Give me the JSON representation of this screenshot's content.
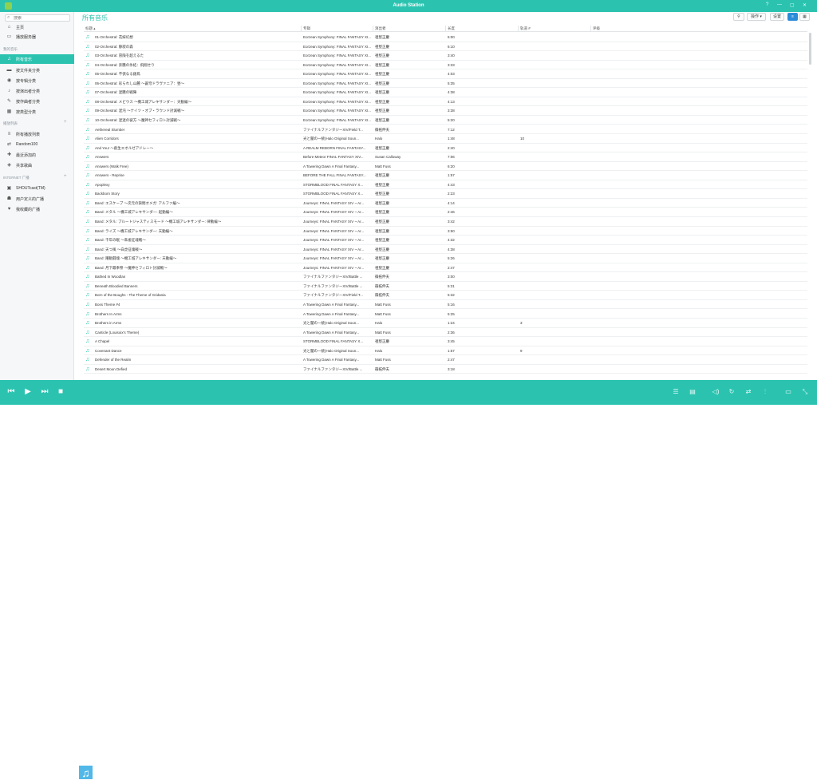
{
  "app": {
    "title": "Audio Station",
    "window_controls": [
      "?",
      "—",
      "▢",
      "✕"
    ]
  },
  "sidebar": {
    "search_placeholder": "搜索",
    "top_items": [
      {
        "label": "主页",
        "icon": "home-icon"
      },
      {
        "label": "播放服务器",
        "icon": "server-icon"
      }
    ],
    "library_section": "我的音乐",
    "library_items": [
      {
        "label": "所有音乐",
        "icon": "music-note-icon",
        "active": true
      },
      {
        "label": "按文件夹分类",
        "icon": "folder-icon"
      },
      {
        "label": "按专辑分类",
        "icon": "album-icon"
      },
      {
        "label": "按演出者分类",
        "icon": "microphone-icon"
      },
      {
        "label": "按作曲者分类",
        "icon": "composer-icon"
      },
      {
        "label": "按类型分类",
        "icon": "genre-icon"
      }
    ],
    "playlist_section": "播放列表",
    "playlist_items": [
      {
        "label": "所有播放列表",
        "icon": "list-icon"
      },
      {
        "label": "Random100",
        "icon": "shuffle-list-icon"
      },
      {
        "label": "最近添加的",
        "icon": "recent-icon"
      },
      {
        "label": "共享歌曲",
        "icon": "share-icon"
      }
    ],
    "radio_section": "INTERNET 广播",
    "radio_items": [
      {
        "label": "SHOUTcast(TM)",
        "icon": "radio-icon"
      },
      {
        "label": "用户定义的广播",
        "icon": "user-radio-icon"
      },
      {
        "label": "我收藏的广播",
        "icon": "heart-icon"
      }
    ]
  },
  "main": {
    "title": "所有音乐",
    "toolbar": {
      "action_label": "操作 ▾",
      "settings_label": "设置"
    },
    "columns": [
      "标题 ▴",
      "专辑",
      "演出者",
      "长度",
      "轨道 #",
      "评级"
    ],
    "rows": [
      [
        "01-Orchestral: 花嫁幻想",
        "Eorzean Symphony: FINAL FANTASY XI...",
        "祖堅正慶",
        "5:00",
        ""
      ],
      [
        "02-Orchestral: 静寂の森",
        "Eorzean Symphony: FINAL FANTASY XI...",
        "祖堅正慶",
        "6:10",
        ""
      ],
      [
        "03-Orchestral: 冒険を超えるた",
        "Eorzean Symphony: FINAL FANTASY XI...",
        "祖堅正慶",
        "3:40",
        ""
      ],
      [
        "04-Orchestral: 奔騰の氷結：飛翔せり",
        "Eorzean Symphony: FINAL FANTASY XI...",
        "祖堅正慶",
        "3:33",
        ""
      ],
      [
        "05-Orchestral: 不倶なる銀鳥",
        "Eorzean Symphony: FINAL FANTASY XI...",
        "祖堅正慶",
        "4:03",
        ""
      ],
      [
        "06-Orchestral: 彩られし山麓 ～蒼穹ドラヴァニア：昼～",
        "Eorzean Symphony: FINAL FANTASY XI...",
        "祖堅正慶",
        "5:35",
        ""
      ],
      [
        "07-Orchestral: 混騰の戦陣",
        "Eorzean Symphony: FINAL FANTASY XI...",
        "祖堅正慶",
        "4:38",
        ""
      ],
      [
        "08-Orchestral: メビウス ～機工城アレキサンダー：天動編～",
        "Eorzean Symphony: FINAL FANTASY XI...",
        "祖堅正慶",
        "4:13",
        ""
      ],
      [
        "09-Orchestral: 混沌 ～ナイツ・オブ・ラウンド討滅戦～",
        "Eorzean Symphony: FINAL FANTASY XI...",
        "祖堅正慶",
        "3:38",
        ""
      ],
      [
        "10-Orchestral: 混迷の彼方 ～魔神セフィロト討滅戦～",
        "Eorzean Symphony: FINAL FANTASY XI...",
        "祖堅正慶",
        "5:20",
        ""
      ],
      [
        "Aethereal Slumber",
        "ファイナルファンタジーXIV/Field T...",
        "篠拓伸夫",
        "7:12",
        ""
      ],
      [
        "Alien Corridors",
        "光と闇の一統(Halo Original Soun...",
        "Halo",
        "1:48",
        "10"
      ],
      [
        "And You! ～創生エオルゼアドレー～",
        "A REALM REBORN FINAL FANTASY...",
        "祖堅正慶",
        "2:40",
        ""
      ],
      [
        "Answers",
        "Before Meteor FINAL FANTASY XIV...",
        "Susan Calloway",
        "7:06",
        ""
      ],
      [
        "Answers (Walk Free)",
        "A Towering Dawn A Final Fantasy...",
        "Matt Fuss",
        "6:20",
        ""
      ],
      [
        "Answers - Reprise",
        "BEFORE THE FALL FINAL FANTASY...",
        "祖堅正慶",
        "1:57",
        ""
      ],
      [
        "Apoplexy",
        "STORMBLOOD FINAL FANTASY X...",
        "祖堅正慶",
        "4:43",
        ""
      ],
      [
        "Backborn Story",
        "STORMBLOOD FINAL FANTASY X...",
        "祖堅正慶",
        "2:23",
        ""
      ],
      [
        "Band: エスケープ ～次元の狭間オメガ: アルファ編～",
        "Journeys: FINAL FANTASY XIV ~ Ar...",
        "祖堅正慶",
        "4:14",
        ""
      ],
      [
        "Band: メタル ～機工城アレキサンダー: 起動編～",
        "Journeys: FINAL FANTASY XIV ~ Ar...",
        "祖堅正慶",
        "2:46",
        ""
      ],
      [
        "Band: メタル: ブルートジャスティスモード ～機工城アレキサンダー: 律動編～",
        "Journeys: FINAL FANTASY XIV ~ Ar...",
        "祖堅正慶",
        "3:42",
        ""
      ],
      [
        "Band: ライズ ～機工城アレキサンダー: 天動編～",
        "Journeys: FINAL FANTASY XIV ~ Ar...",
        "祖堅正慶",
        "3:50",
        ""
      ],
      [
        "Band: 千年の眠 ～朱雀征魂戦～",
        "Journeys: FINAL FANTASY XIV ~ Ar...",
        "祖堅正慶",
        "4:32",
        ""
      ],
      [
        "Band: 天つ風 ～白虎征魂戦～",
        "Journeys: FINAL FANTASY XIV ~ Ar...",
        "祖堅正慶",
        "4:38",
        ""
      ],
      [
        "Band: 躍動闘魂 ～機工城アレキサンダー: 天動編～",
        "Journeys: FINAL FANTASY XIV ~ Ar...",
        "祖堅正慶",
        "5:26",
        ""
      ],
      [
        "Band: 月下最奉祭 ～魔神セフィロト討滅戦～",
        "Journeys: FINAL FANTASY XIV ~ Ar...",
        "祖堅正慶",
        "2:47",
        ""
      ],
      [
        "Bathed In Woodlan",
        "ファイナルファンタジーXIV/Battle ...",
        "篠拓伸夫",
        "3:00",
        ""
      ],
      [
        "Beneath Bloodied Banners",
        "ファイナルファンタジーXIV/Battle ...",
        "篠拓伸夫",
        "5:31",
        ""
      ],
      [
        "Born of the Boughs - The Theme of Gridania",
        "ファイナルファンタジーXIV/Field T...",
        "篠拓伸夫",
        "5:32",
        ""
      ],
      [
        "Boss Theme #4",
        "A Towering Dawn A Final Fantasy...",
        "Matt Fuss",
        "5:16",
        ""
      ],
      [
        "Brothers In Arms",
        "A Towering Dawn A Final Fantasy...",
        "Matt Fuss",
        "5:25",
        ""
      ],
      [
        "Brothers in Arms",
        "光と闇の一統(Halo Original Soun...",
        "Halo",
        "1:24",
        "3"
      ],
      [
        "Canticle (Louisoix's Theme)",
        "A Towering Dawn A Final Fantasy...",
        "Matt Fuss",
        "2:36",
        ""
      ],
      [
        "A Chapel",
        "STORMBLOOD FINAL FANTASY X...",
        "祖堅正慶",
        "3:45",
        ""
      ],
      [
        "Covenant Dance",
        "光と闇の一統(Halo Original Soun...",
        "Halo",
        "1:57",
        "9"
      ],
      [
        "Defender of the Realm",
        "A Towering Dawn A Final Fantasy...",
        "Matt Fuss",
        "2:47",
        ""
      ],
      [
        "Desert Moon Defied",
        "ファイナルファンタジーXIV/Battle ...",
        "篠拓伸夫",
        "3:18",
        ""
      ]
    ]
  },
  "player": {
    "cover_icon": "music-note-icon"
  }
}
